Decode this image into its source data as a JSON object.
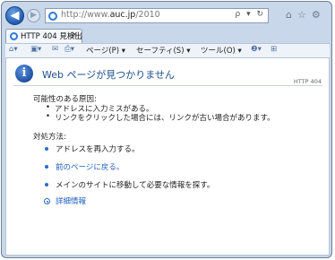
{
  "browser": {
    "address": {
      "scheme": "http://www.",
      "host": "auc.jp",
      "path": "/2010"
    },
    "address_tools": "ρ ▾ ↻",
    "right_icons": [
      "home-icon",
      "star-icon",
      "gear-icon"
    ],
    "tab": {
      "title": "HTTP 404 見検出",
      "close": "×"
    },
    "command_bar": {
      "items": [
        {
          "name": "ページ(P)",
          "suffix": "▾"
        },
        {
          "name": "セーフティ(S)",
          "suffix": "▾"
        },
        {
          "name": "ツール(O)",
          "suffix": "▾"
        }
      ]
    }
  },
  "page": {
    "heading": "Web ページが見つかりません",
    "http_code": "HTTP 404",
    "causes_title": "可能性のある原因:",
    "causes": [
      "アドレスに入力ミスがある。",
      "リンクをクリックした場合には、リンクが古い場合があります。"
    ],
    "solutions_title": "対処方法:",
    "solutions": [
      {
        "text": "アドレスを再入力する。",
        "link": false
      },
      {
        "text": "前のページに戻る。",
        "link": true
      },
      {
        "text": "メインのサイトに移動して必要な情報を探す。",
        "link": false
      }
    ],
    "more_info": "詳細情報"
  }
}
